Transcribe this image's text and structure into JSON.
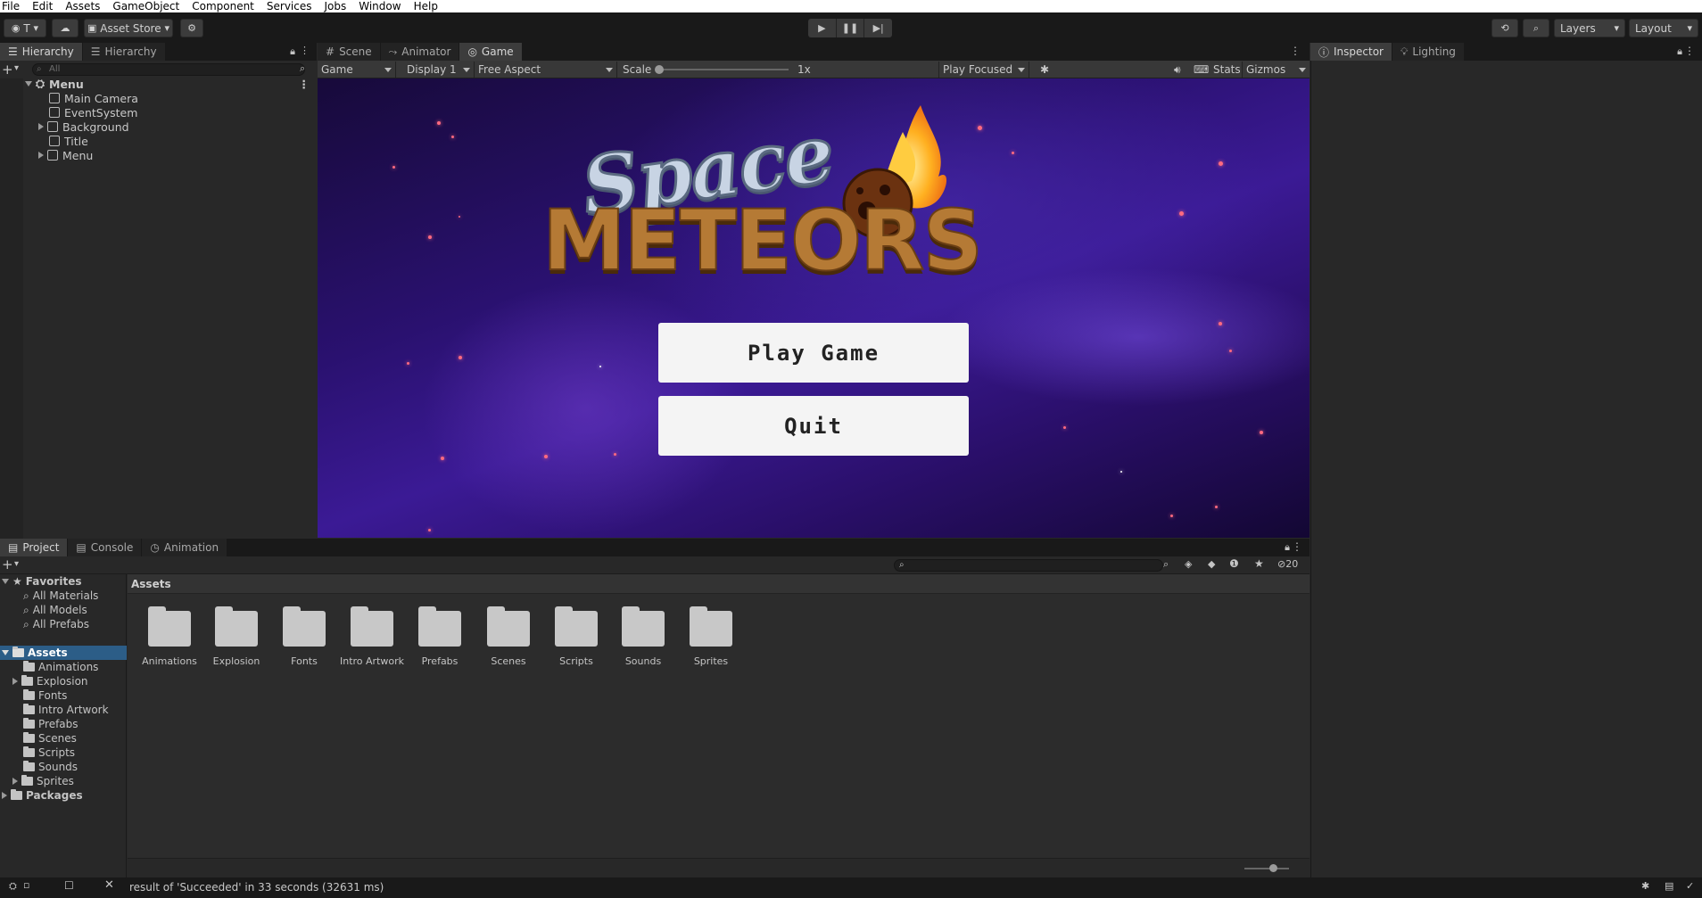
{
  "menu": [
    "File",
    "Edit",
    "Assets",
    "GameObject",
    "Component",
    "Services",
    "Jobs",
    "Window",
    "Help"
  ],
  "toolbar": {
    "account_label": "T",
    "asset_store": "Asset Store",
    "layers": "Layers",
    "layout": "Layout"
  },
  "hierarchy": {
    "tabs": [
      "Hierarchy",
      "Hierarchy"
    ],
    "search_placeholder": "All",
    "items": [
      {
        "label": "Menu",
        "depth": 0
      },
      {
        "label": "Main Camera",
        "depth": 1
      },
      {
        "label": "EventSystem",
        "depth": 1
      },
      {
        "label": "Background",
        "depth": 1
      },
      {
        "label": "Title",
        "depth": 1
      },
      {
        "label": "Menu",
        "depth": 1
      }
    ]
  },
  "center_tabs": [
    "Scene",
    "Animator",
    "Game"
  ],
  "gamebar": {
    "view": "Game",
    "display": "Display 1",
    "aspect": "Free Aspect",
    "scale_label": "Scale",
    "scale_value": "1x",
    "play_mode": "Play Focused",
    "stats": "Stats",
    "gizmos": "Gizmos"
  },
  "game": {
    "title_top": "Space",
    "title_bottom": "METEORS",
    "buttons": [
      "Play Game",
      "Quit"
    ]
  },
  "right_tabs": [
    "Inspector",
    "Lighting"
  ],
  "bottom_tabs": [
    "Project",
    "Console",
    "Animation"
  ],
  "project": {
    "badge": "20",
    "favorites_label": "Favorites",
    "favorites": [
      "All Materials",
      "All Models",
      "All Prefabs"
    ],
    "assets_label": "Assets",
    "packages_label": "Packages",
    "tree": [
      "Animations",
      "Explosion",
      "Fonts",
      "Intro Artwork",
      "Prefabs",
      "Scenes",
      "Scripts",
      "Sounds",
      "Sprites"
    ],
    "folders": [
      "Animations",
      "Explosion",
      "Fonts",
      "Intro Artwork",
      "Prefabs",
      "Scenes",
      "Scripts",
      "Sounds",
      "Sprites"
    ]
  },
  "status": {
    "message": "result of 'Succeeded' in 33 seconds (32631 ms)"
  }
}
